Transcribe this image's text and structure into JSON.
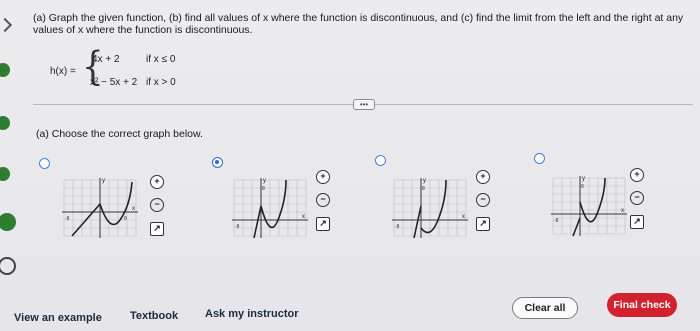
{
  "question": {
    "text": "(a) Graph the given function, (b) find all values of x where the function is discontinuous, and (c) find the limit from the left and the right at any values of x where the function is discontinuous."
  },
  "function": {
    "name": "h(x) =",
    "piece1_expr": "4x + 2",
    "piece1_cond": "if x ≤ 0",
    "piece2_expr": "x² − 5x + 2",
    "piece2_cond": "if x > 0"
  },
  "part_a": {
    "prompt": "(a) Choose the correct graph below.",
    "selected_option": "B",
    "options": [
      {
        "id": "A",
        "selected": false
      },
      {
        "id": "B",
        "selected": true
      },
      {
        "id": "C",
        "selected": false
      },
      {
        "id": "D",
        "selected": false
      }
    ],
    "graph_labels": {
      "y": "y",
      "x": "x",
      "a": "8",
      "b": "8",
      "c": "-8"
    }
  },
  "footer": {
    "view_example": "View an example",
    "textbook": "Textbook",
    "ask_instructor": "Ask my instructor",
    "clear_all": "Clear all",
    "final_check": "Final check"
  },
  "icons": [
    "zoom-in-icon",
    "zoom-out-icon",
    "popout-icon"
  ],
  "colors": {
    "accent_blue": "#3367d6",
    "final_check_red": "#d2222f",
    "status_green": "#2e7d32"
  }
}
